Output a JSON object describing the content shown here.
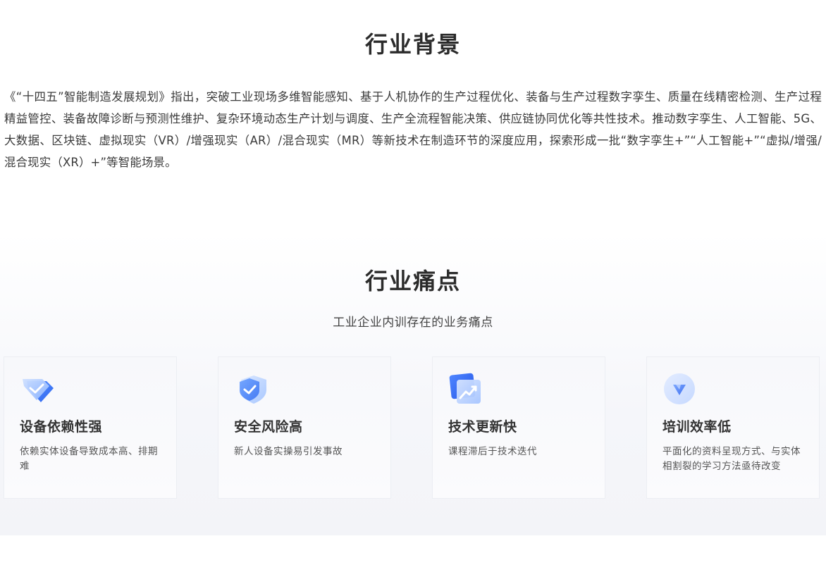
{
  "background": {
    "title": "行业背景",
    "paragraph": "《“十四五”智能制造发展规划》指出，突破工业现场多维智能感知、基于人机协作的生产过程优化、装备与生产过程数字孪生、质量在线精密检测、生产过程精益管控、装备故障诊断与预测性维护、复杂环境动态生产计划与调度、生产全流程智能决策、供应链协同优化等共性技术。推动数字孪生、人工智能、5G、大数据、区块链、虚拟现实（VR）/增强现实（AR）/混合现实（MR）等新技术在制造环节的深度应用，探索形成一批“数字孪生+”“人工智能+”“虚拟/增强/混合现实（XR）+”等智能场景。"
  },
  "pain_points": {
    "title": "行业痛点",
    "subtitle": "工业企业内训存在的业务痛点",
    "cards": [
      {
        "icon": "diamond-check-icon",
        "title": "设备依赖性强",
        "desc": "依赖实体设备导致成本高、排期难"
      },
      {
        "icon": "shield-check-icon",
        "title": "安全风险高",
        "desc": "新人设备实操易引发事故"
      },
      {
        "icon": "trend-chart-icon",
        "title": "技术更新快",
        "desc": "课程滞后于技术迭代"
      },
      {
        "icon": "triangle-badge-icon",
        "title": "培训效率低",
        "desc": "平面化的资料呈现方式、与实体相割裂的学习方法亟待改变"
      }
    ]
  },
  "colors": {
    "accent": "#3d7bf7",
    "accent_light": "#9fc3ff",
    "title": "#2b2b2b"
  }
}
